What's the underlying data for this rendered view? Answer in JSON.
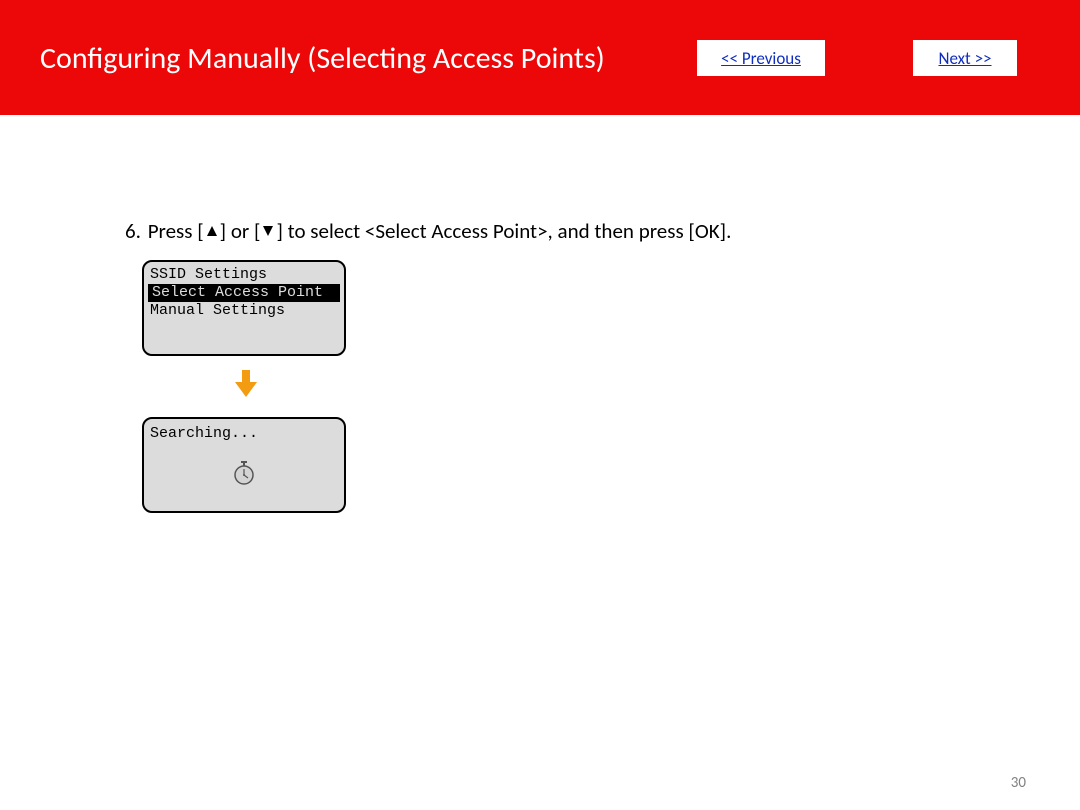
{
  "header": {
    "title": "Configuring Manually (Selecting Access Points)",
    "prev_label": "<< Previous",
    "next_label": "Next >>"
  },
  "instruction": {
    "step_number": "6.",
    "text_part1": " Press [",
    "text_part2": "] or [",
    "text_part3": "] to select <Select Access Point>, and then press [OK]."
  },
  "lcd1": {
    "title": "SSID Settings",
    "items": [
      {
        "label": " Select Access Point",
        "selected": true
      },
      {
        "label": " Manual Settings",
        "selected": false
      }
    ]
  },
  "lcd2": {
    "text": "Searching..."
  },
  "page_number": "30",
  "colors": {
    "banner": "#ec0808",
    "link": "#0f2dbf",
    "arrow": "#f39c12"
  }
}
